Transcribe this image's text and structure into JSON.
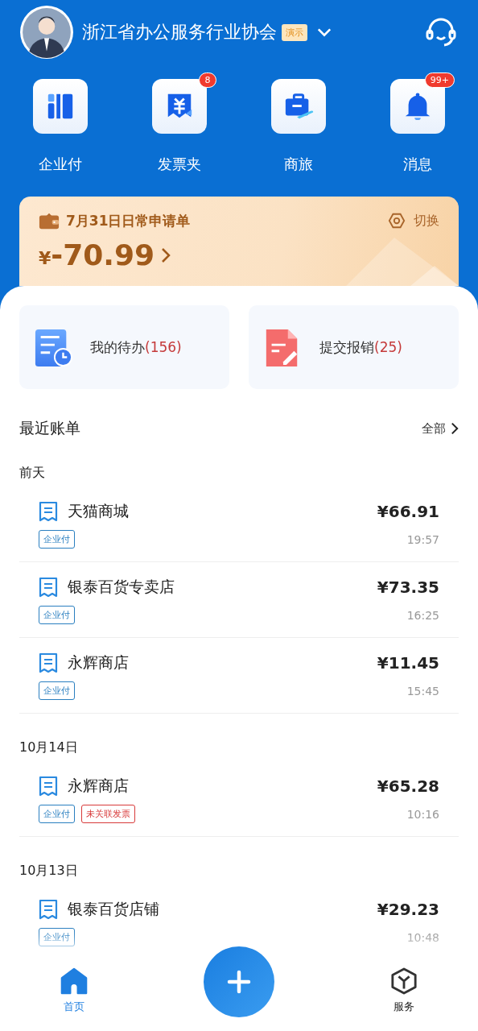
{
  "header": {
    "org_name": "浙江省办公服务行业协会",
    "org_tag": "演示"
  },
  "shortcuts": [
    {
      "kind": "pay",
      "label": "企业付"
    },
    {
      "kind": "invoice",
      "label": "发票夹",
      "badge": "8"
    },
    {
      "kind": "travel",
      "label": "商旅"
    },
    {
      "kind": "message",
      "label": "消息",
      "badge": "99+"
    }
  ],
  "application": {
    "title": "7月31日日常申请单",
    "currency": "¥",
    "amount": "-70.99",
    "switch_label": "切换"
  },
  "tasks": [
    {
      "kind": "todo",
      "label": "我的待办",
      "count": "(156)"
    },
    {
      "kind": "submit",
      "label": "提交报销",
      "count": "(25)"
    }
  ],
  "recent_bills": {
    "title": "最近账单",
    "more": "全部",
    "groups": [
      {
        "date": "前天",
        "items": [
          {
            "merchant": "天猫商城",
            "amount": "¥66.91",
            "time": "19:57",
            "tags": [
              {
                "kind": "pay",
                "text": "企业付"
              }
            ]
          },
          {
            "merchant": "银泰百货专卖店",
            "amount": "¥73.35",
            "time": "16:25",
            "tags": [
              {
                "kind": "pay",
                "text": "企业付"
              }
            ]
          },
          {
            "merchant": "永辉商店",
            "amount": "¥11.45",
            "time": "15:45",
            "tags": [
              {
                "kind": "pay",
                "text": "企业付"
              }
            ]
          }
        ]
      },
      {
        "date": "10月14日",
        "items": [
          {
            "merchant": "永辉商店",
            "amount": "¥65.28",
            "time": "10:16",
            "tags": [
              {
                "kind": "pay",
                "text": "企业付"
              },
              {
                "kind": "warning",
                "text": "未关联发票"
              }
            ]
          }
        ]
      },
      {
        "date": "10月13日",
        "items": [
          {
            "merchant": "银泰百货店铺",
            "amount": "¥29.23",
            "time": "10:48",
            "tags": [
              {
                "kind": "pay",
                "text": "企业付"
              }
            ]
          }
        ]
      }
    ]
  },
  "bottom_nav": [
    {
      "kind": "home",
      "label": "首页",
      "selected": true
    },
    {
      "kind": "add"
    },
    {
      "kind": "service",
      "label": "服务",
      "selected": false
    }
  ]
}
